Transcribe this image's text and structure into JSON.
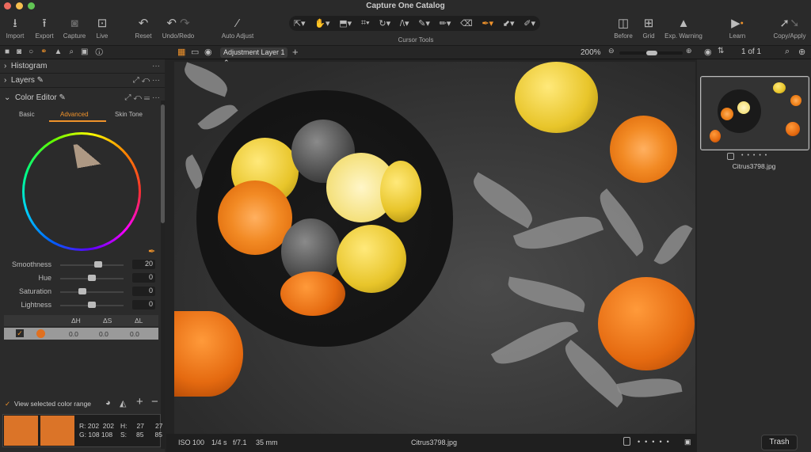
{
  "window": {
    "title": "Capture One Catalog"
  },
  "toolbar": {
    "import": "Import",
    "export": "Export",
    "capture": "Capture",
    "live": "Live",
    "reset": "Reset",
    "undo_redo": "Undo/Redo",
    "auto_adjust": "Auto Adjust",
    "cursor_tools": "Cursor Tools",
    "before": "Before",
    "grid": "Grid",
    "exp_warning": "Exp. Warning",
    "learn": "Learn",
    "copy_apply": "Copy/Apply"
  },
  "viewer_bar": {
    "layer": "Adjustment Layer 1",
    "zoom": "200%",
    "count": "1 of 1"
  },
  "left_panel": {
    "sections": {
      "histogram": "Histogram",
      "layers": "Layers",
      "color_editor": "Color Editor"
    },
    "tabs": [
      "Basic",
      "Advanced",
      "Skin Tone"
    ],
    "active_tab": "Advanced",
    "sliders": [
      {
        "label": "Smoothness",
        "value": "20",
        "position": 0.6
      },
      {
        "label": "Hue",
        "value": "0",
        "position": 0.5
      },
      {
        "label": "Saturation",
        "value": "0",
        "position": 0.35
      },
      {
        "label": "Lightness",
        "value": "0",
        "position": 0.5
      }
    ],
    "table": {
      "headers": [
        "ΔH",
        "ΔS",
        "ΔL"
      ],
      "row": {
        "checked": true,
        "swatch": "#e07020",
        "dh": "0.0",
        "ds": "0.0",
        "dl": "0.0"
      }
    },
    "view_range": "View selected color range",
    "readout": {
      "r_label": "R:",
      "r1": "202",
      "r2": "202",
      "g_label": "G:",
      "g1": "108",
      "g2": "108",
      "h_label": "H:",
      "h1": "27",
      "h2": "27",
      "s_label": "S:",
      "s1": "85",
      "s2": "85"
    },
    "swatch_color": "#db7428"
  },
  "status": {
    "iso": "ISO 100",
    "shutter": "1/4 s",
    "aperture": "f/7.1",
    "focal": "35 mm",
    "filename": "Citrus3798.jpg"
  },
  "browser": {
    "thumb_name": "Citrus3798.jpg",
    "trash": "Trash"
  },
  "colors": {
    "accent": "#f0932b",
    "bg": "#2b2b2b"
  }
}
